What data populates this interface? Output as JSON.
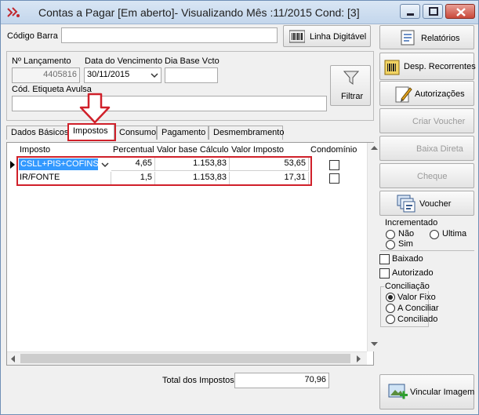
{
  "window": {
    "title": "Contas a Pagar [Em aberto]- Visualizando Mês :11/2015 Cond: [3]",
    "colors": {
      "highlight": "#3399ff",
      "annotation": "#d0202a",
      "titlebar": "#c3d6ec"
    }
  },
  "header": {
    "barcode_label": "Código Barra",
    "barcode_value": "",
    "linha_digitavel_label": "Linha Digitável",
    "lancamento_label": "Nº Lançamento",
    "lancamento_value": "4405816",
    "vencimento_label": "Data do Vencimento",
    "vencimento_value": "30/11/2015",
    "dia_base_label": "Dia Base Vcto",
    "dia_base_value": "",
    "etiqueta_label": "Cód. Etiqueta Avulsa",
    "etiqueta_value": "",
    "filtrar_label": "Filtrar"
  },
  "tabs": [
    {
      "label": "Dados Básicos"
    },
    {
      "label": "Impostos"
    },
    {
      "label": "Consumo"
    },
    {
      "label": "Pagamento"
    },
    {
      "label": "Desmembramento"
    }
  ],
  "grid": {
    "columns": [
      "Imposto",
      "Percentual",
      "Valor base Cálculo",
      "Valor Imposto",
      "Condomínio"
    ],
    "rows": [
      {
        "imposto": "CSLL+PIS+COFINS",
        "percentual": "4,65",
        "base": "1.153,83",
        "valor": "53,65"
      },
      {
        "imposto": "IR/FONTE",
        "percentual": "1,5",
        "base": "1.153,83",
        "valor": "17,31"
      }
    ]
  },
  "total": {
    "label": "Total dos Impostos",
    "value": "70,96"
  },
  "sidebar": {
    "relatorios": "Relatórios",
    "desp_recorrentes": "Desp. Recorrentes",
    "autorizacoes": "Autorizações",
    "criar_voucher": "Criar Voucher",
    "baixa_direta": "Baixa Direta",
    "cheque": "Cheque",
    "voucher": "Voucher",
    "incrementado_label": "Incrementado",
    "inc_nao": "Não",
    "inc_ultima": "Ultima",
    "inc_sim": "Sim",
    "baixado": "Baixado",
    "autorizado": "Autorizado",
    "conciliacao_label": "Conciliação",
    "conc_fixo": "Valor Fixo",
    "conc_a_conciliar": "A Conciliar",
    "conc_conciliado": "Conciliado",
    "vincular_imagem": "Vincular Imagem"
  }
}
